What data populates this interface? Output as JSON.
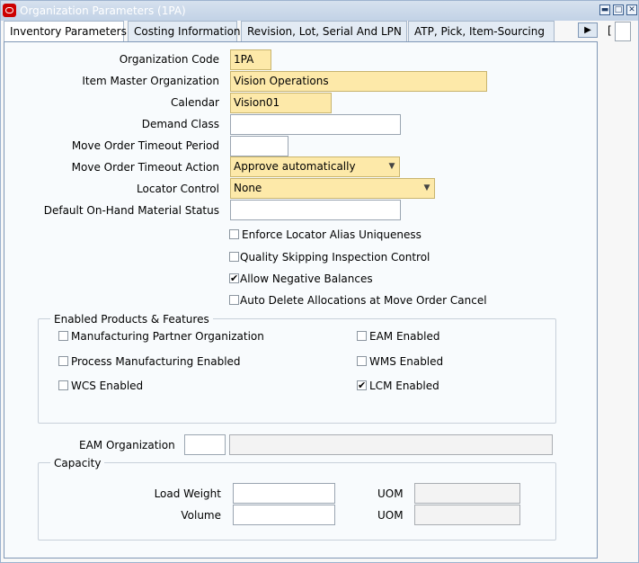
{
  "window": {
    "title": "Organization Parameters (1PA)"
  },
  "tabs": [
    {
      "label": "Inventory Parameters",
      "active": true
    },
    {
      "label": "Costing Information",
      "active": false
    },
    {
      "label": "Revision, Lot, Serial And LPN",
      "active": false
    },
    {
      "label": "ATP, Pick, Item-Sourcing",
      "active": false
    }
  ],
  "side_indicator": "[",
  "form": {
    "organization_code": {
      "label": "Organization Code",
      "value": "1PA"
    },
    "item_master_org": {
      "label": "Item Master Organization",
      "value": "Vision Operations"
    },
    "calendar": {
      "label": "Calendar",
      "value": "Vision01"
    },
    "demand_class": {
      "label": "Demand Class",
      "value": ""
    },
    "move_order_timeout_period": {
      "label": "Move Order Timeout Period",
      "value": ""
    },
    "move_order_timeout_action": {
      "label": "Move Order Timeout Action",
      "value": "Approve automatically"
    },
    "locator_control": {
      "label": "Locator Control",
      "value": "None"
    },
    "default_onhand_status": {
      "label": "Default On-Hand Material Status",
      "value": ""
    }
  },
  "options": [
    {
      "label": "Enforce Locator Alias Uniqueness",
      "checked": false
    },
    {
      "label": "Quality Skipping Inspection Control",
      "checked": false
    },
    {
      "label": "Allow Negative Balances",
      "checked": true
    },
    {
      "label": "Auto Delete Allocations at Move Order Cancel",
      "checked": false
    }
  ],
  "products": {
    "title": "Enabled Products & Features",
    "items": [
      {
        "label": "Manufacturing Partner Organization",
        "checked": false
      },
      {
        "label": "EAM Enabled",
        "checked": false
      },
      {
        "label": "Process Manufacturing Enabled",
        "checked": false
      },
      {
        "label": "WMS Enabled",
        "checked": false
      },
      {
        "label": "WCS Enabled",
        "checked": false
      },
      {
        "label": "LCM Enabled",
        "checked": true
      }
    ]
  },
  "eam": {
    "label": "EAM Organization",
    "code": "",
    "name": ""
  },
  "capacity": {
    "title": "Capacity",
    "load_weight": {
      "label": "Load Weight",
      "value": "",
      "uom_label": "UOM",
      "uom": ""
    },
    "volume": {
      "label": "Volume",
      "value": "",
      "uom_label": "UOM",
      "uom": ""
    }
  },
  "checkmark": "✔"
}
